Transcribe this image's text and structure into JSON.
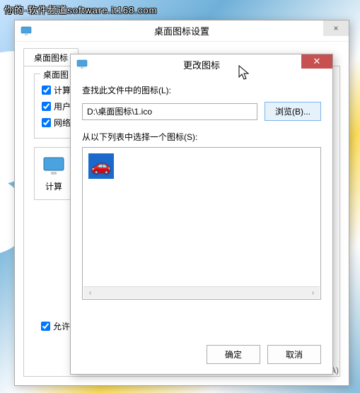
{
  "watermark": "你的·软件频道software.it168.com",
  "parent": {
    "title": "桌面图标设置",
    "close_label": "×",
    "tab_label": "桌面图标",
    "fieldset_legend": "桌面图",
    "checkboxes": {
      "computer": "计算",
      "user": "用户",
      "network": "网络"
    },
    "icon_label": "计算",
    "allow_themes_label": "允许主",
    "apply_stub": "A)"
  },
  "child": {
    "title": "更改图标",
    "close_label": "✕",
    "find_label": "查找此文件中的图标(L):",
    "path_value": "D:\\桌面图标\\1.ico",
    "browse_label": "浏览(B)...",
    "select_label": "从以下列表中选择一个图标(S):",
    "scroll_left": "‹",
    "scroll_right": "›",
    "ok_label": "确定",
    "cancel_label": "取消"
  }
}
